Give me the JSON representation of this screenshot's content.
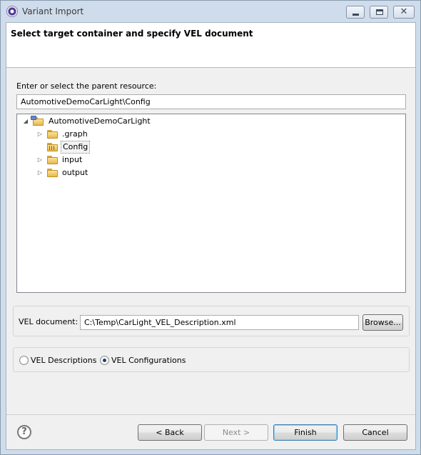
{
  "window": {
    "title": "Variant Import"
  },
  "banner": {
    "title": "Select target container and specify VEL document"
  },
  "parent_resource": {
    "label": "Enter or select the parent resource:",
    "value": "AutomotiveDemoCarLight\\Config"
  },
  "tree": {
    "root": {
      "label": "AutomotiveDemoCarLight",
      "expanded": true
    },
    "children": [
      {
        "label": ".graph",
        "selected": false
      },
      {
        "label": "Config",
        "selected": true
      },
      {
        "label": "input",
        "selected": false
      },
      {
        "label": "output",
        "selected": false
      }
    ]
  },
  "vel_document": {
    "label": "VEL document:",
    "value": "C:\\Temp\\CarLight_VEL_Description.xml",
    "browse_label": "Browse..."
  },
  "mode": {
    "options": [
      {
        "label": "VEL Descriptions",
        "checked": false
      },
      {
        "label": "VEL Configurations",
        "checked": true
      }
    ]
  },
  "footer": {
    "help_glyph": "?",
    "back_label": "< Back",
    "next_label": "Next >",
    "finish_label": "Finish",
    "cancel_label": "Cancel"
  },
  "colors": {
    "title_bar": "#cfdceb",
    "dialog_bg": "#f0f0f0",
    "default_button_border": "#3c7fb1"
  }
}
